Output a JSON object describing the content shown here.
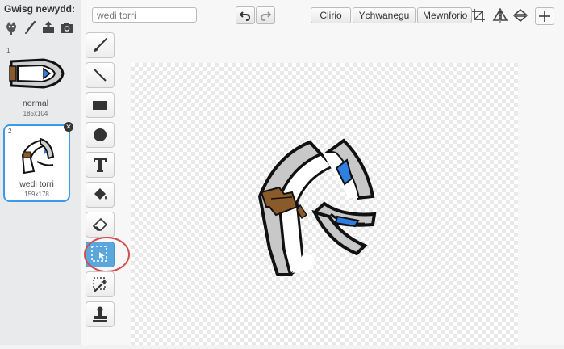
{
  "costumes_panel": {
    "new_costume_label": "Gwisg newydd:",
    "new_icons": [
      "character-icon",
      "paintbrush-icon",
      "upload-icon",
      "camera-icon"
    ],
    "costumes": [
      {
        "number": "1",
        "name": "normal",
        "size": "185x104",
        "selected": false
      },
      {
        "number": "2",
        "name": "wedi torri",
        "size": "159x178",
        "selected": true
      }
    ]
  },
  "editor": {
    "costume_name_value": "wedi torri",
    "buttons": {
      "clear": "Clirio",
      "add": "Ychwanegu",
      "import": "Mewnforio"
    },
    "tools": [
      "brush-icon",
      "line-icon",
      "rectangle-icon",
      "ellipse-icon",
      "text-icon",
      "fill-icon",
      "eraser-icon",
      "select-icon",
      "magic-wand-icon",
      "stamp-icon"
    ],
    "active_tool": "select-icon",
    "colors": {
      "accent": "#3b9be8",
      "active_tool": "#5aa7dd",
      "highlight_circle": "#d84a4a"
    }
  }
}
